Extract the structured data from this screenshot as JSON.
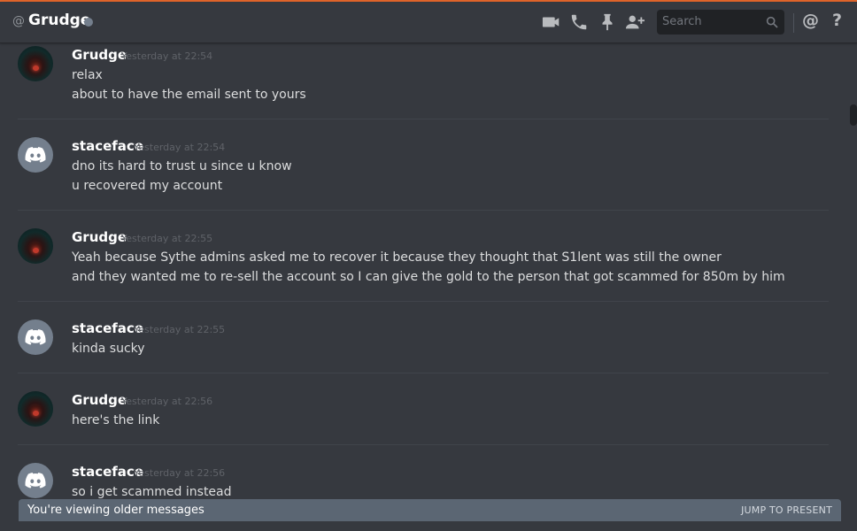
{
  "header": {
    "at_symbol": "@",
    "channel_name": "Grudge",
    "search_placeholder": "Search",
    "mention_label": "@",
    "help_label": "?",
    "icons": [
      "video-icon",
      "phone-icon",
      "pin-icon",
      "add-friend-icon",
      "search-icon"
    ]
  },
  "messages": [
    {
      "author": "Grudge",
      "avatar": "grudge-avatar",
      "time": "Yesterday at 22:54",
      "lines": [
        "relax",
        "about to have the email sent to yours"
      ]
    },
    {
      "author": "staceface",
      "avatar": "discord-default-avatar",
      "time": "Yesterday at 22:54",
      "lines": [
        "dno its hard to trust u since u know",
        "u recovered my account"
      ]
    },
    {
      "author": "Grudge",
      "avatar": "grudge-avatar",
      "time": "Yesterday at 22:55",
      "lines": [
        "Yeah because Sythe admins asked me to recover it because they thought that S1lent was still the owner",
        "and they wanted me to re-sell the account so I can give the gold to the person that got scammed for 850m by him"
      ]
    },
    {
      "author": "staceface",
      "avatar": "discord-default-avatar",
      "time": "Yesterday at 22:55",
      "lines": [
        "kinda sucky"
      ]
    },
    {
      "author": "Grudge",
      "avatar": "grudge-avatar",
      "time": "Yesterday at 22:56",
      "lines": [
        "here's the link"
      ]
    },
    {
      "author": "staceface",
      "avatar": "discord-default-avatar",
      "time": "Yesterday at 22:56",
      "lines": [
        "so i get scammed instead"
      ]
    }
  ],
  "older_bar": {
    "text": "You're viewing older messages",
    "jump_label": "JUMP TO PRESENT"
  },
  "colors": {
    "background": "#36393f",
    "accent_top": "#e0652b",
    "older_bar": "#5b6673",
    "status_offline": "#747f8d"
  }
}
